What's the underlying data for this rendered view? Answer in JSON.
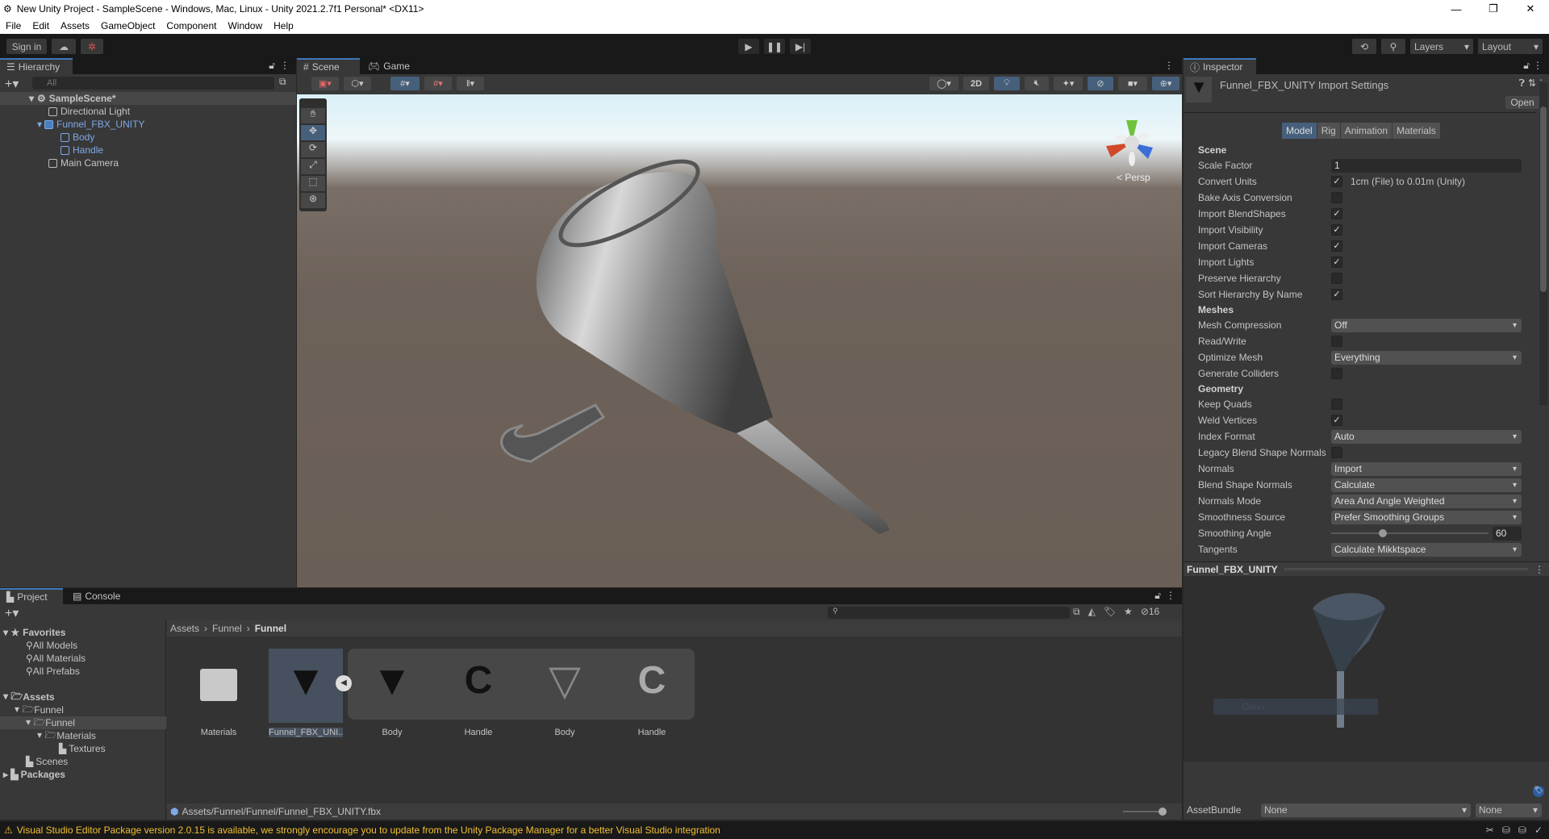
{
  "window": {
    "title": "New Unity Project - SampleScene - Windows, Mac, Linux - Unity 2021.2.7f1 Personal* <DX11>"
  },
  "menu": [
    "File",
    "Edit",
    "Assets",
    "GameObject",
    "Component",
    "Window",
    "Help"
  ],
  "toolbar": {
    "sign_in": "Sign in",
    "layers": "Layers",
    "layout": "Layout"
  },
  "hierarchy": {
    "tab": "Hierarchy",
    "search_placeholder": "All",
    "scene": "SampleScene*",
    "items": [
      {
        "label": "Directional Light"
      },
      {
        "label": "Funnel_FBX_UNITY"
      },
      {
        "label": "Body"
      },
      {
        "label": "Handle"
      },
      {
        "label": "Main Camera"
      }
    ]
  },
  "scene": {
    "tabs": [
      "Scene",
      "Game"
    ],
    "two_d": "2D",
    "persp": "Persp",
    "gizmo_axes": [
      "y",
      "x",
      "z"
    ]
  },
  "inspector": {
    "tab": "Inspector",
    "title": "Funnel_FBX_UNITY Import Settings",
    "open": "Open",
    "tabs": [
      "Model",
      "Rig",
      "Animation",
      "Materials"
    ],
    "rows": [
      {
        "type": "header",
        "label": "Scene"
      },
      {
        "type": "field",
        "label": "Scale Factor",
        "value": "1"
      },
      {
        "type": "check",
        "label": "Convert Units",
        "checked": true,
        "note": "1cm (File) to 0.01m (Unity)"
      },
      {
        "type": "check",
        "label": "Bake Axis Conversion",
        "checked": false
      },
      {
        "type": "check",
        "label": "Import BlendShapes",
        "checked": true
      },
      {
        "type": "check",
        "label": "Import Visibility",
        "checked": true
      },
      {
        "type": "check",
        "label": "Import Cameras",
        "checked": true
      },
      {
        "type": "check",
        "label": "Import Lights",
        "checked": true
      },
      {
        "type": "check",
        "label": "Preserve Hierarchy",
        "checked": false
      },
      {
        "type": "check",
        "label": "Sort Hierarchy By Name",
        "checked": true
      },
      {
        "type": "header",
        "label": "Meshes"
      },
      {
        "type": "dropdown",
        "label": "Mesh Compression",
        "value": "Off"
      },
      {
        "type": "check",
        "label": "Read/Write",
        "checked": false
      },
      {
        "type": "dropdown",
        "label": "Optimize Mesh",
        "value": "Everything"
      },
      {
        "type": "check",
        "label": "Generate Colliders",
        "checked": false
      },
      {
        "type": "header",
        "label": "Geometry"
      },
      {
        "type": "check",
        "label": "Keep Quads",
        "checked": false
      },
      {
        "type": "check",
        "label": "Weld Vertices",
        "checked": true
      },
      {
        "type": "dropdown",
        "label": "Index Format",
        "value": "Auto"
      },
      {
        "type": "check",
        "label": "Legacy Blend Shape Normals",
        "checked": false
      },
      {
        "type": "dropdown",
        "label": "Normals",
        "value": "Import"
      },
      {
        "type": "dropdown",
        "label": "Blend Shape Normals",
        "value": "Calculate"
      },
      {
        "type": "dropdown",
        "label": "Normals Mode",
        "value": "Area And Angle Weighted"
      },
      {
        "type": "dropdown",
        "label": "Smoothness Source",
        "value": "Prefer Smoothing Groups"
      },
      {
        "type": "slider",
        "label": "Smoothing Angle",
        "value": "60",
        "fraction": 0.33
      },
      {
        "type": "dropdown",
        "label": "Tangents",
        "value": "Calculate Mikktspace"
      }
    ],
    "preview_title": "Funnel_FBX_UNITY",
    "preview_overlay": "Окно",
    "assetbundle": {
      "label": "AssetBundle",
      "name": "None",
      "variant": "None"
    }
  },
  "project": {
    "tabs": [
      "Project",
      "Console"
    ],
    "hidden_count": "16",
    "favorites": {
      "label": "Favorites",
      "items": [
        "All Models",
        "All Materials",
        "All Prefabs"
      ]
    },
    "tree": [
      {
        "label": "Assets",
        "depth": 0
      },
      {
        "label": "Funnel",
        "depth": 1
      },
      {
        "label": "Funnel",
        "depth": 2
      },
      {
        "label": "Materials",
        "depth": 3
      },
      {
        "label": "Textures",
        "depth": 4
      },
      {
        "label": "Scenes",
        "depth": 1
      },
      {
        "label": "Packages",
        "depth": 0
      }
    ],
    "breadcrumb": [
      "Assets",
      "Funnel",
      "Funnel"
    ],
    "assets": [
      {
        "label": "Materials"
      },
      {
        "label": "Funnel_FBX_UNI..."
      },
      {
        "label": "Body"
      },
      {
        "label": "Handle"
      },
      {
        "label": "Body"
      },
      {
        "label": "Handle"
      }
    ],
    "path": "Assets/Funnel/Funnel/Funnel_FBX_UNITY.fbx"
  },
  "status": {
    "message": "Visual Studio Editor Package version 2.0.15 is available, we strongly encourage you to update from the Unity Package Manager for a better Visual Studio integration"
  },
  "colors": {
    "accent": "#3a79bb",
    "selected": "#46607c",
    "warning": "#f0c030"
  }
}
